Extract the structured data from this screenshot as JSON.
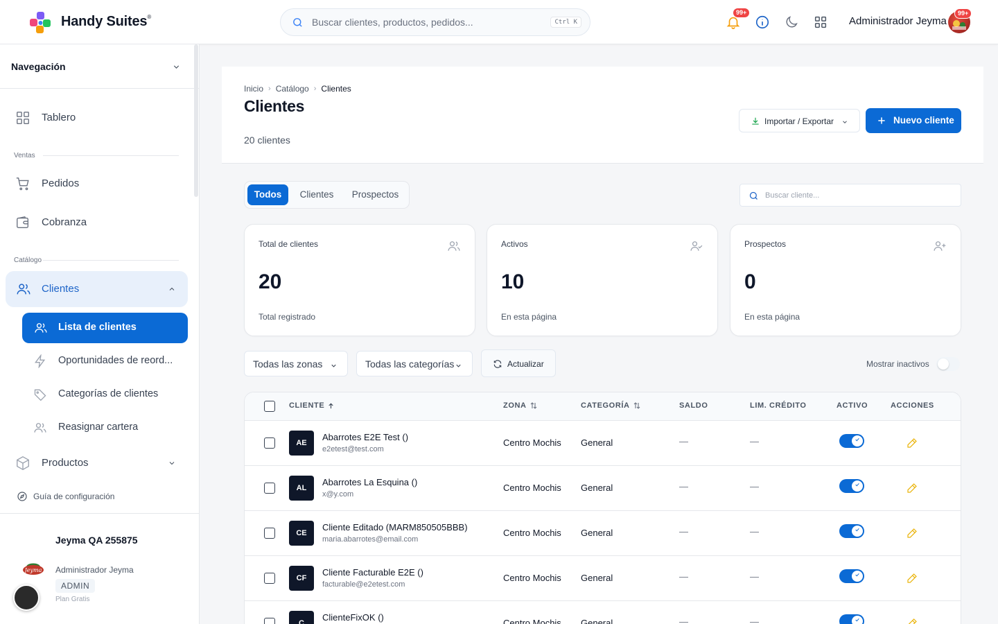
{
  "topbar": {
    "brand": "Handy Suites",
    "brand_mark": "®",
    "search_placeholder": "Buscar clientes, productos, pedidos...",
    "search_shortcut": "Ctrl K",
    "notifications_badge": "99+",
    "user_name": "Administrador Jeyma",
    "avatar_badge": "99+"
  },
  "sidebar": {
    "nav_title": "Navegación",
    "items": {
      "tablero": "Tablero",
      "pedidos": "Pedidos",
      "cobranza": "Cobranza",
      "clientes": "Clientes",
      "productos": "Productos"
    },
    "sections": {
      "ventas": "Ventas",
      "catalogo": "Catálogo"
    },
    "subitems": {
      "lista": "Lista de clientes",
      "oportunidades": "Oportunidades de reord...",
      "categorias": "Categorías de clientes",
      "reasignar": "Reasignar cartera"
    },
    "guide": "Guía de configuración",
    "footer": {
      "company": "Jeyma QA 255875",
      "user": "Administrador Jeyma",
      "role": "ADMIN",
      "plan": "Plan Gratis",
      "logo_text": "Jeyma"
    }
  },
  "header": {
    "breadcrumb": [
      "Inicio",
      "Catálogo",
      "Clientes"
    ],
    "title": "Clientes",
    "count": "20 clientes",
    "import_export": "Importar / Exportar",
    "new_client": "Nuevo cliente"
  },
  "tabs": [
    "Todos",
    "Clientes",
    "Prospectos"
  ],
  "client_search_placeholder": "Buscar cliente...",
  "stats": [
    {
      "title": "Total de clientes",
      "value": "20",
      "sub": "Total registrado",
      "icon": "users-icon"
    },
    {
      "title": "Activos",
      "value": "10",
      "sub": "En esta página",
      "icon": "user-check-icon"
    },
    {
      "title": "Prospectos",
      "value": "0",
      "sub": "En esta página",
      "icon": "user-plus-icon"
    }
  ],
  "filters": {
    "zones": "Todas las zonas",
    "categories": "Todas las categorías",
    "refresh": "Actualizar",
    "show_inactive": "Mostrar inactivos"
  },
  "table": {
    "columns": {
      "cliente": "CLIENTE",
      "zona": "ZONA",
      "categoria": "CATEGORÍA",
      "saldo": "SALDO",
      "limite": "LIM. CRÉDITO",
      "activo": "ACTIVO",
      "acciones": "ACCIONES"
    },
    "rows": [
      {
        "initials": "AE",
        "name": "Abarrotes E2E Test ()",
        "email": "e2etest@test.com",
        "zone": "Centro Mochis",
        "category": "General",
        "balance": "—",
        "credit": "—",
        "active": true
      },
      {
        "initials": "AL",
        "name": "Abarrotes La Esquina ()",
        "email": "x@y.com",
        "zone": "Centro Mochis",
        "category": "General",
        "balance": "—",
        "credit": "—",
        "active": true
      },
      {
        "initials": "CE",
        "name": "Cliente Editado (MARM850505BBB)",
        "email": "maria.abarrotes@email.com",
        "zone": "Centro Mochis",
        "category": "General",
        "balance": "—",
        "credit": "—",
        "active": true
      },
      {
        "initials": "CF",
        "name": "Cliente Facturable E2E ()",
        "email": "facturable@e2etest.com",
        "zone": "Centro Mochis",
        "category": "General",
        "balance": "—",
        "credit": "—",
        "active": true
      },
      {
        "initials": "C",
        "name": "ClienteFixOK ()",
        "email": "",
        "zone": "Centro Mochis",
        "category": "General",
        "balance": "—",
        "credit": "—",
        "active": true
      }
    ]
  },
  "colors": {
    "primary": "#0b6ad5",
    "active_bg": "#e8f0fb",
    "badge": "#ef4444",
    "edit": "#eab308"
  }
}
